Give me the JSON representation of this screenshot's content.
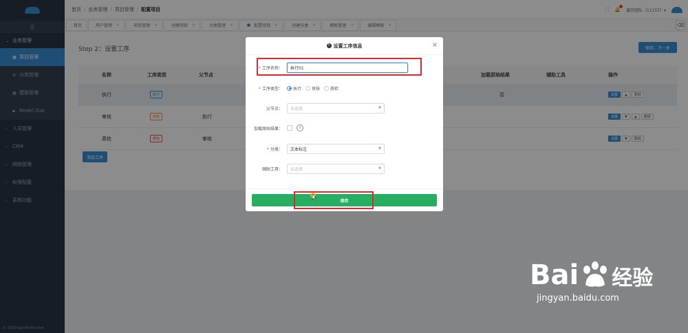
{
  "breadcrumbs": [
    "首页",
    "业务管理",
    "项目管理",
    "配置项目"
  ],
  "header_user": "演示团队（11157）▾",
  "sidebar": {
    "sections": [
      {
        "label": "业务管理",
        "expanded": true
      },
      {
        "label": "人员管理"
      },
      {
        "label": "CRM"
      },
      {
        "label": "网络管理"
      },
      {
        "label": "权限配置"
      },
      {
        "label": "系统功能"
      }
    ],
    "sub_items": [
      {
        "label": "项目管理",
        "active": true
      },
      {
        "label": "分类管理"
      },
      {
        "label": "模板管理"
      },
      {
        "label": "Model Zoo"
      }
    ],
    "copyright": "© 2018 basicfinder.com"
  },
  "tabs": [
    {
      "label": "首页"
    },
    {
      "label": "用户管理"
    },
    {
      "label": "项目管理"
    },
    {
      "label": "创建项目"
    },
    {
      "label": "分类管理"
    },
    {
      "label": "配置项目",
      "active": true
    },
    {
      "label": "创建分类"
    },
    {
      "label": "模板管理"
    },
    {
      "label": "编辑模板"
    }
  ],
  "page": {
    "step_title": "Step 2：设置工序",
    "next_button": "保存，下一步",
    "add_button": "添加工序"
  },
  "table": {
    "headers": {
      "name": "名称",
      "type": "工序类型",
      "parent": "父节点",
      "load": "加载原始结果",
      "aux": "辅助工具",
      "ops": "操作"
    },
    "rows": [
      {
        "name": "执行",
        "type": "执行",
        "parent": "",
        "load": "否",
        "highlight": true,
        "ops": [
          "设置",
          "▲",
          "删除"
        ]
      },
      {
        "name": "审核",
        "type": "审核",
        "parent": "执行",
        "load": "",
        "ops": [
          "设置",
          "▼",
          "▲",
          "删除"
        ]
      },
      {
        "name": "质检",
        "type": "质检",
        "parent": "审核",
        "load": "",
        "ops": [
          "设置",
          "▼",
          "删除"
        ]
      }
    ]
  },
  "modal": {
    "title": "设置工序信息",
    "fields": {
      "name_label": "工序名称：",
      "name_value": "执行01",
      "type_label": "工序类型：",
      "type_options": [
        "执行",
        "审核",
        "质检"
      ],
      "type_selected": "执行",
      "parent_label": "父节点：",
      "parent_placeholder": "未选择",
      "load_label": "加载原始结果：",
      "category_label": "分类：",
      "category_value": "文本标注",
      "aux_label": "辅助工具：",
      "aux_placeholder": "未选择"
    },
    "save_button": "保存"
  },
  "watermark": {
    "brand_left": "Bai",
    "brand_right": "经验",
    "url": "jingyan.baidu.com"
  },
  "colors": {
    "sidebar_bg": "#2b3643",
    "accent_blue": "#3a8fd6",
    "save_green": "#27ae60",
    "highlight_red": "#e0282c"
  }
}
